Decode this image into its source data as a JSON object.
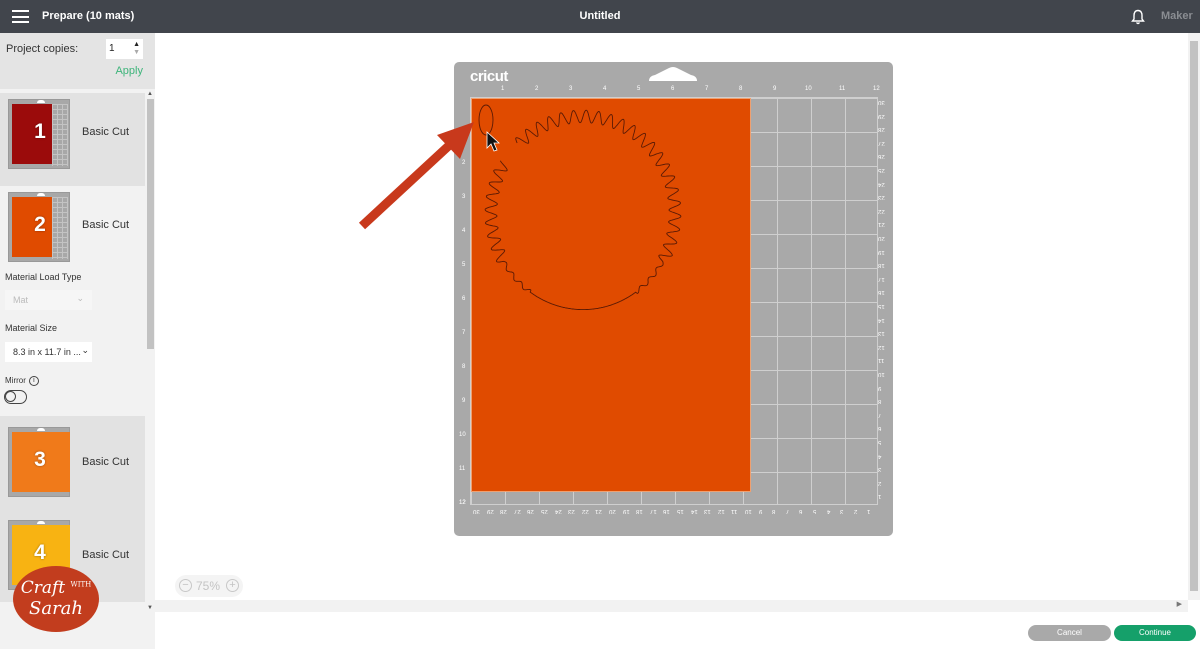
{
  "header": {
    "prepare_title": "Prepare (10 mats)",
    "document_title": "Untitled",
    "machine_label": "Maker"
  },
  "sidebar": {
    "project_copies_label": "Project copies:",
    "project_copies_value": "1",
    "apply_label": "Apply",
    "mats": [
      {
        "number": "1",
        "label": "Basic Cut",
        "color": "#9b0b0b",
        "selected": true
      },
      {
        "number": "2",
        "label": "Basic Cut",
        "color": "#e04b00",
        "selected": false
      },
      {
        "number": "3",
        "label": "Basic Cut",
        "color": "#f07a1a",
        "selected": false
      },
      {
        "number": "4",
        "label": "Basic Cut",
        "color": "#f8b312",
        "selected": false
      }
    ],
    "material_load_type_label": "Material Load Type",
    "material_load_type_value": "Mat",
    "material_size_label": "Material Size",
    "material_size_value": "8.3 in x 11.7 in ...",
    "mirror_label": "Mirror",
    "mirror_on": false
  },
  "canvas": {
    "mat_brand": "cricut",
    "material_color": "#e04b00",
    "ruler_top": [
      "1",
      "2",
      "3",
      "4",
      "5",
      "6",
      "7",
      "8",
      "9",
      "10",
      "11",
      "12"
    ],
    "ruler_left": [
      "2",
      "3",
      "4",
      "5",
      "6",
      "7",
      "8",
      "9",
      "10",
      "11",
      "12"
    ],
    "ruler_right": [
      "30",
      "29",
      "28",
      "27",
      "26",
      "25",
      "24",
      "23",
      "22",
      "21",
      "20",
      "19",
      "18",
      "17",
      "16",
      "15",
      "14",
      "13",
      "12",
      "11",
      "10",
      "9",
      "8",
      "7",
      "6",
      "5",
      "4",
      "3",
      "2",
      "1"
    ],
    "ruler_bottom": [
      "30",
      "29",
      "28",
      "27",
      "26",
      "25",
      "24",
      "23",
      "22",
      "21",
      "20",
      "19",
      "18",
      "17",
      "16",
      "15",
      "14",
      "13",
      "12",
      "11",
      "10",
      "9",
      "8",
      "7",
      "6",
      "5",
      "4",
      "3",
      "2",
      "1"
    ],
    "zoom_level": "75%"
  },
  "watermark": {
    "line1": "Craft",
    "line1_small": "WITH",
    "line2": "Sarah"
  },
  "footer": {
    "cancel_label": "Cancel",
    "continue_label": "Continue"
  },
  "icons": {
    "menu": "hamburger-icon",
    "bell": "bell-icon",
    "chevron": "chevron-down-icon",
    "info": "info-icon",
    "zoom_out": "zoom-out-icon",
    "zoom_in": "zoom-in-icon"
  }
}
